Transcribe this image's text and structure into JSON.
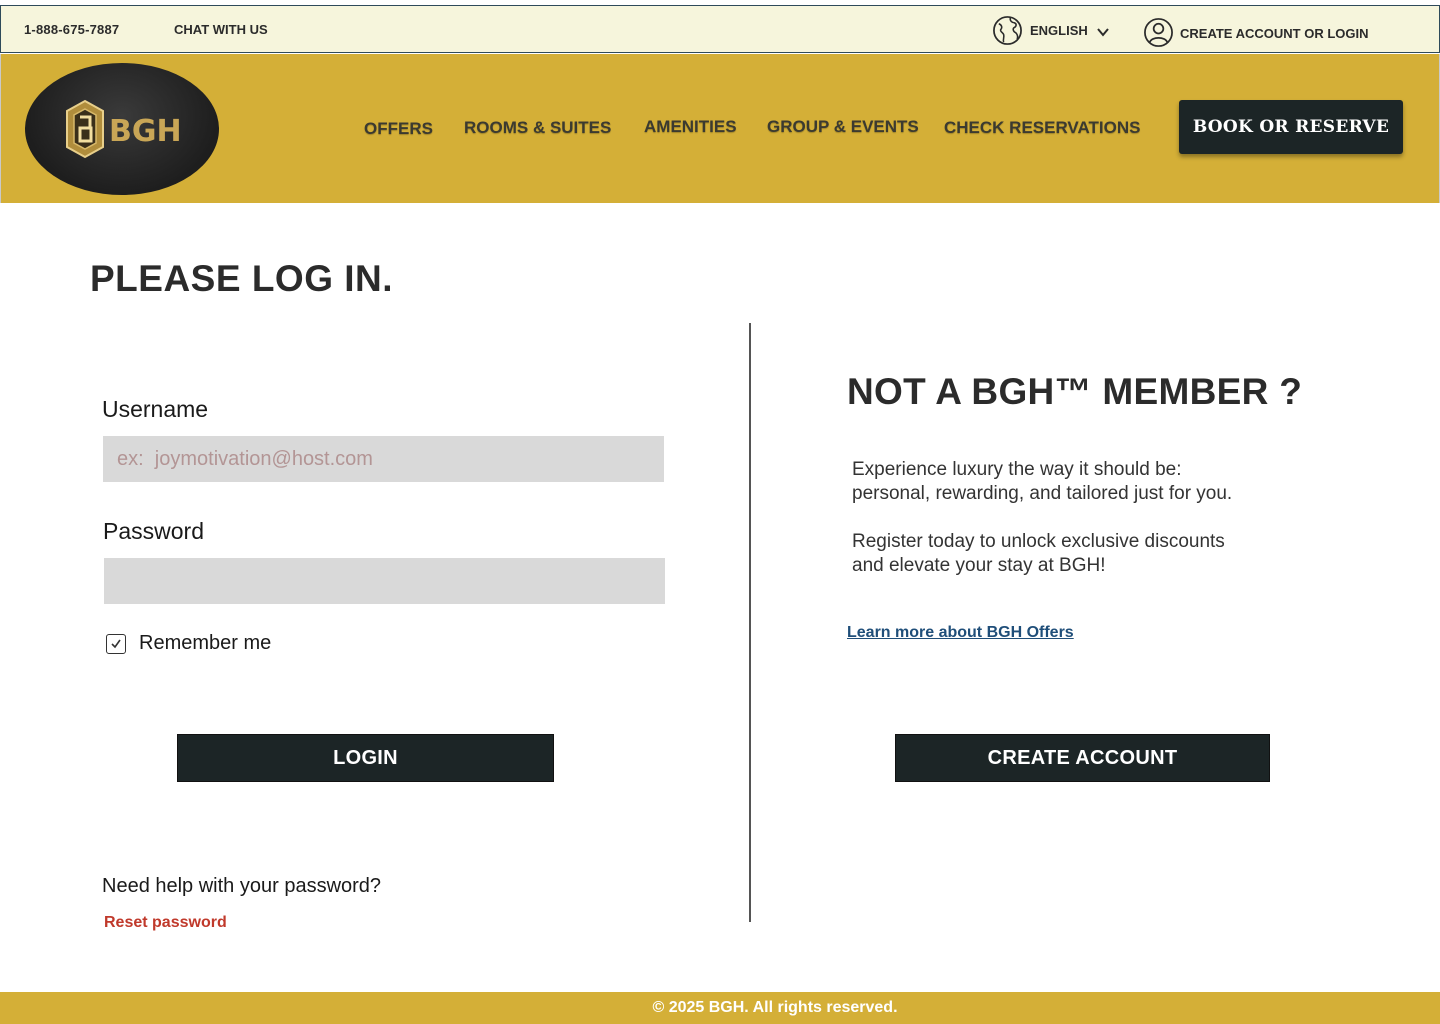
{
  "topbar": {
    "phone": "1-888-675-7887",
    "chat": "CHAT WITH US",
    "language": "ENGLISH",
    "account": "CREATE ACCOUNT OR LOGIN"
  },
  "header": {
    "logo_text": "BGH",
    "nav": [
      "OFFERS",
      "ROOMS & SUITES",
      "AMENITIES",
      "GROUP & EVENTS",
      "CHECK RESERVATIONS"
    ],
    "book_button": "BOOK OR RESERVE"
  },
  "login": {
    "title": "PLEASE LOG IN.",
    "username_label": "Username",
    "username_placeholder": "ex:  joymotivation@host.com",
    "password_label": "Password",
    "remember_label": "Remember me",
    "remember_checked": true,
    "login_button": "LOGIN",
    "help_text": "Need help with your password?",
    "reset_link": "Reset password"
  },
  "member": {
    "title": "NOT A BGH™ MEMBER ?",
    "line1": "Experience luxury the way it should be:",
    "line2": "personal, rewarding, and tailored just for you.",
    "line3": "Register today to unlock exclusive discounts",
    "line4": "and elevate your stay at BGH!",
    "learn_link": "Learn more about BGH Offers",
    "create_button": "CREATE ACCOUNT"
  },
  "footer": {
    "copyright": "© 2025 BGH. All rights reserved."
  },
  "colors": {
    "gold": "#d4af37",
    "cream": "#f6f5dc",
    "dark": "#1c2526",
    "link_blue": "#1f4e79",
    "reset_red": "#c0392b"
  }
}
